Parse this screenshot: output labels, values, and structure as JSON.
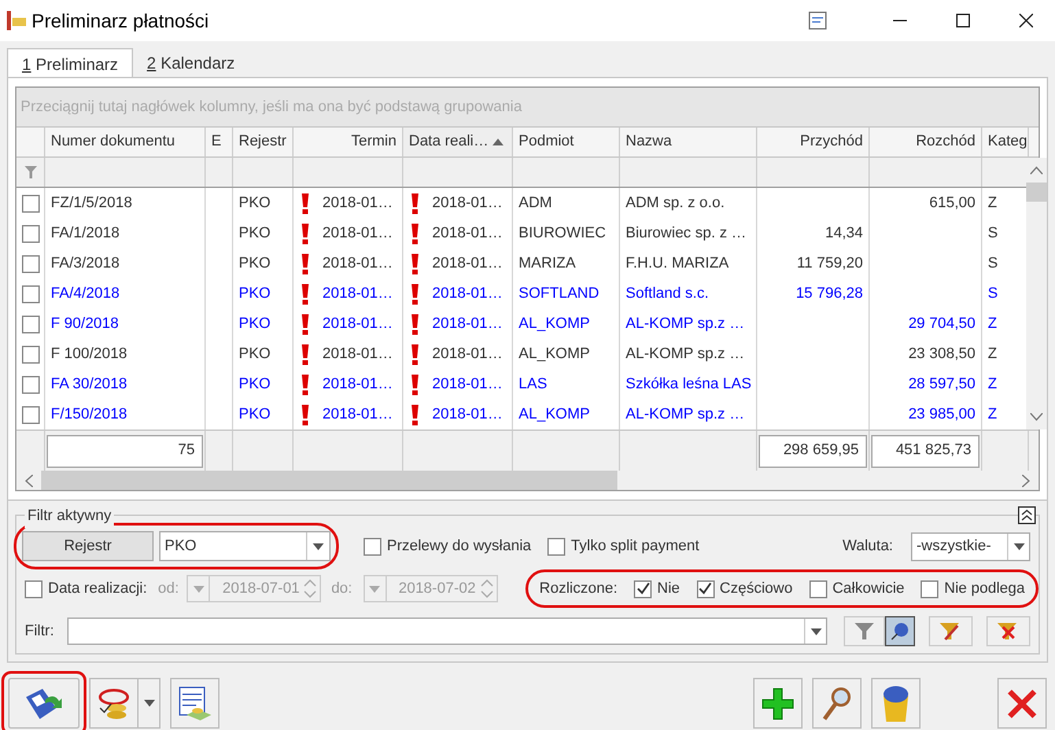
{
  "window": {
    "title": "Preliminarz płatności"
  },
  "tabs": [
    {
      "hotkey": "1",
      "label": "Preliminarz",
      "selected": true
    },
    {
      "hotkey": "2",
      "label": "Kalendarz",
      "selected": false
    }
  ],
  "grid": {
    "group_hint": "Przeciągnij tutaj nagłówek kolumny, jeśli ma ona być podstawą grupowania",
    "columns": [
      {
        "label": "Numer dokumentu",
        "sorted_ascending": false
      },
      {
        "label": "E",
        "sorted_ascending": false
      },
      {
        "label": "Rejestr",
        "sorted_ascending": false
      },
      {
        "label": "Termin",
        "sorted_ascending": false
      },
      {
        "label": "Data reali…",
        "sorted_ascending": true
      },
      {
        "label": "Podmiot",
        "sorted_ascending": false
      },
      {
        "label": "Nazwa",
        "sorted_ascending": false
      },
      {
        "label": "Przychód",
        "sorted_ascending": false
      },
      {
        "label": "Rozchód",
        "sorted_ascending": false
      },
      {
        "label": "Kateg",
        "sorted_ascending": false
      }
    ],
    "rows": [
      {
        "checked": false,
        "color": "#333333",
        "numer": "FZ/1/5/2018",
        "rejestr": "PKO",
        "overdue": true,
        "termin": "2018-01…",
        "data": "2018-01…",
        "podmiot": "ADM",
        "nazwa": "ADM sp. z o.o.",
        "rozchod": "615,00",
        "kategoria": "Z"
      },
      {
        "checked": false,
        "color": "#333333",
        "numer": "FA/1/2018",
        "rejestr": "PKO",
        "overdue": true,
        "termin": "2018-01…",
        "data": "2018-01…",
        "podmiot": "BIUROWIEC",
        "nazwa": "Biurowiec sp. z …",
        "przychod": "14,34",
        "kategoria": "S"
      },
      {
        "checked": false,
        "color": "#333333",
        "numer": "FA/3/2018",
        "rejestr": "PKO",
        "overdue": true,
        "termin": "2018-01…",
        "data": "2018-01…",
        "podmiot": "MARIZA",
        "nazwa": "F.H.U. MARIZA",
        "przychod": "11 759,20",
        "kategoria": "S"
      },
      {
        "checked": false,
        "color": "#0000ff",
        "numer": "FA/4/2018",
        "rejestr": "PKO",
        "overdue": true,
        "termin": "2018-01…",
        "data": "2018-01…",
        "podmiot": "SOFTLAND",
        "nazwa": "Softland s.c.",
        "przychod": "15 796,28",
        "kategoria": "S"
      },
      {
        "checked": false,
        "color": "#0000ff",
        "numer": "F 90/2018",
        "rejestr": "PKO",
        "overdue": true,
        "termin": "2018-01…",
        "data": "2018-01…",
        "podmiot": "AL_KOMP",
        "nazwa": "AL-KOMP sp.z …",
        "rozchod": "29 704,50",
        "kategoria": "Z"
      },
      {
        "checked": false,
        "color": "#333333",
        "numer": "F 100/2018",
        "rejestr": "PKO",
        "overdue": true,
        "termin": "2018-01…",
        "data": "2018-01…",
        "podmiot": "AL_KOMP",
        "nazwa": "AL-KOMP sp.z …",
        "rozchod": "23 308,50",
        "kategoria": "Z"
      },
      {
        "checked": false,
        "color": "#0000ff",
        "numer": "FA 30/2018",
        "rejestr": "PKO",
        "overdue": true,
        "termin": "2018-01…",
        "data": "2018-01…",
        "podmiot": "LAS",
        "nazwa": "Szkółka leśna LAS",
        "rozchod": "28 597,50",
        "kategoria": "Z"
      },
      {
        "checked": false,
        "color": "#0000ff",
        "numer": "F/150/2018",
        "rejestr": "PKO",
        "overdue": true,
        "termin": "2018-01…",
        "data": "2018-01…",
        "podmiot": "AL_KOMP",
        "nazwa": "AL-KOMP sp.z …",
        "rozchod": "23 985,00",
        "kategoria": "Z"
      }
    ],
    "footer": {
      "count": "75",
      "przychod": "298 659,95",
      "rozchod": "451 825,73"
    }
  },
  "filter": {
    "title": "Filtr aktywny",
    "rejestr": {
      "button": "Rejestr",
      "value": "PKO",
      "highlighted": true
    },
    "przelewy": {
      "label": "Przelewy do wysłania",
      "checked": false
    },
    "split": {
      "label": "Tylko split payment",
      "checked": false
    },
    "waluta": {
      "label": "Waluta:",
      "value": "-wszystkie-"
    },
    "data_realizacji": {
      "label": "Data realizacji:",
      "checked": false,
      "od_label": "od:",
      "od": "2018-07-01",
      "do_label": "do:",
      "do": "2018-07-02"
    },
    "rozliczone": {
      "label": "Rozliczone:",
      "highlighted": true,
      "options": [
        {
          "label": "Nie",
          "checked": true
        },
        {
          "label": "Częściowo",
          "checked": true
        },
        {
          "label": "Całkowicie",
          "checked": false
        },
        {
          "label": "Nie podlega",
          "checked": false
        }
      ]
    },
    "filtr": {
      "label": "Filtr:"
    }
  },
  "toolbar": {
    "save_highlighted": true
  }
}
